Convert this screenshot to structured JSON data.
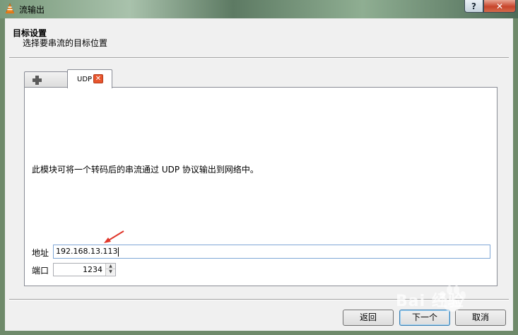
{
  "window": {
    "title": "流输出",
    "help_button": "?",
    "close_button": "✕"
  },
  "header": {
    "title": "目标设置",
    "subtitle": "选择要串流的目标位置"
  },
  "tabs": {
    "add_tab_icon": "plus-icon",
    "active_tab_label": "UDP",
    "close_glyph": "✕"
  },
  "udp_panel": {
    "description": "此模块可将一个转码后的串流通过 UDP 协议输出到网络中。",
    "address_label": "地址",
    "address_value": "192.168.13.113",
    "port_label": "端口",
    "port_value": "1234"
  },
  "buttons": {
    "back": "返回",
    "next": "下一个",
    "cancel": "取消"
  },
  "watermark": {
    "text": "Bai 经验"
  },
  "colors": {
    "accent": "#e8552d",
    "annotation_arrow": "#e0372b"
  }
}
